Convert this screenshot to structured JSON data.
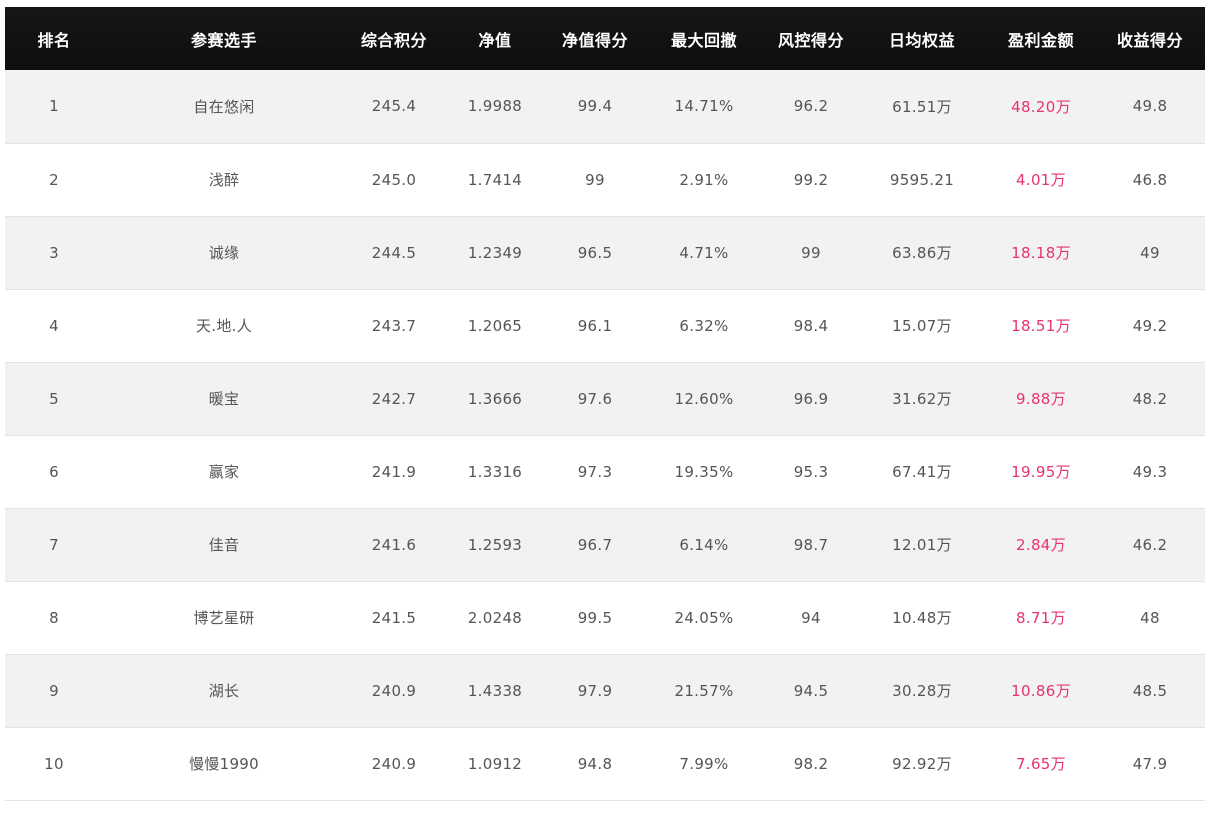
{
  "table": {
    "headers": [
      "排名",
      "参赛选手",
      "综合积分",
      "净值",
      "净值得分",
      "最大回撤",
      "风控得分",
      "日均权益",
      "盈利金额",
      "收益得分"
    ],
    "rows": [
      [
        "1",
        "自在悠闲",
        "245.4",
        "1.9988",
        "99.4",
        "14.71%",
        "96.2",
        "61.51万",
        "48.20万",
        "49.8"
      ],
      [
        "2",
        "浅醉",
        "245.0",
        "1.7414",
        "99",
        "2.91%",
        "99.2",
        "9595.21",
        "4.01万",
        "46.8"
      ],
      [
        "3",
        "诚缘",
        "244.5",
        "1.2349",
        "96.5",
        "4.71%",
        "99",
        "63.86万",
        "18.18万",
        "49"
      ],
      [
        "4",
        "天.地.人",
        "243.7",
        "1.2065",
        "96.1",
        "6.32%",
        "98.4",
        "15.07万",
        "18.51万",
        "49.2"
      ],
      [
        "5",
        "暖宝",
        "242.7",
        "1.3666",
        "97.6",
        "12.60%",
        "96.9",
        "31.62万",
        "9.88万",
        "48.2"
      ],
      [
        "6",
        "赢家",
        "241.9",
        "1.3316",
        "97.3",
        "19.35%",
        "95.3",
        "67.41万",
        "19.95万",
        "49.3"
      ],
      [
        "7",
        "佳音",
        "241.6",
        "1.2593",
        "96.7",
        "6.14%",
        "98.7",
        "12.01万",
        "2.84万",
        "46.2"
      ],
      [
        "8",
        "博艺星研",
        "241.5",
        "2.0248",
        "99.5",
        "24.05%",
        "94",
        "10.48万",
        "8.71万",
        "48"
      ],
      [
        "9",
        "湖长",
        "240.9",
        "1.4338",
        "97.9",
        "21.57%",
        "94.5",
        "30.28万",
        "10.86万",
        "48.5"
      ],
      [
        "10",
        "慢慢1990",
        "240.9",
        "1.0912",
        "94.8",
        "7.99%",
        "98.2",
        "92.92万",
        "7.65万",
        "47.9"
      ]
    ]
  },
  "colors": {
    "header_bg": "#111111",
    "header_text": "#ffffff",
    "row_alt_bg": "#f2f2f2",
    "row_bg": "#ffffff",
    "text": "#555555",
    "profit_text": "#e8336d"
  }
}
